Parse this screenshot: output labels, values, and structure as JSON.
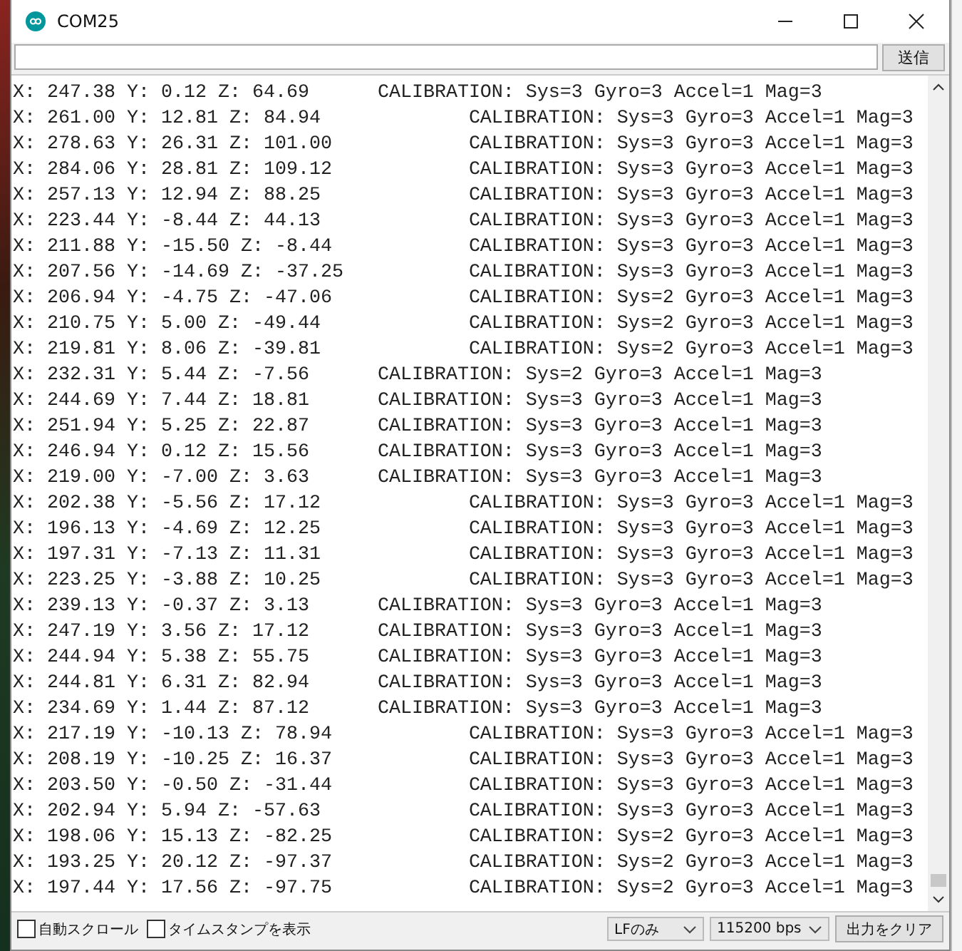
{
  "window": {
    "title": "COM25"
  },
  "input": {
    "button": "送信"
  },
  "output": {
    "lines": [
      "X: 247.38 Y: 0.12 Z: 64.69\tCALIBRATION: Sys=3 Gyro=3 Accel=1 Mag=3",
      "X: 261.00 Y: 12.81 Z: 84.94\t\tCALIBRATION: Sys=3 Gyro=3 Accel=1 Mag=3",
      "X: 278.63 Y: 26.31 Z: 101.00\t\tCALIBRATION: Sys=3 Gyro=3 Accel=1 Mag=3",
      "X: 284.06 Y: 28.81 Z: 109.12\t\tCALIBRATION: Sys=3 Gyro=3 Accel=1 Mag=3",
      "X: 257.13 Y: 12.94 Z: 88.25\t\tCALIBRATION: Sys=3 Gyro=3 Accel=1 Mag=3",
      "X: 223.44 Y: -8.44 Z: 44.13\t\tCALIBRATION: Sys=3 Gyro=3 Accel=1 Mag=3",
      "X: 211.88 Y: -15.50 Z: -8.44\t\tCALIBRATION: Sys=3 Gyro=3 Accel=1 Mag=3",
      "X: 207.56 Y: -14.69 Z: -37.25\t\tCALIBRATION: Sys=3 Gyro=3 Accel=1 Mag=3",
      "X: 206.94 Y: -4.75 Z: -47.06\t\tCALIBRATION: Sys=2 Gyro=3 Accel=1 Mag=3",
      "X: 210.75 Y: 5.00 Z: -49.44\t\tCALIBRATION: Sys=2 Gyro=3 Accel=1 Mag=3",
      "X: 219.81 Y: 8.06 Z: -39.81\t\tCALIBRATION: Sys=2 Gyro=3 Accel=1 Mag=3",
      "X: 232.31 Y: 5.44 Z: -7.56\tCALIBRATION: Sys=2 Gyro=3 Accel=1 Mag=3",
      "X: 244.69 Y: 7.44 Z: 18.81\tCALIBRATION: Sys=3 Gyro=3 Accel=1 Mag=3",
      "X: 251.94 Y: 5.25 Z: 22.87\tCALIBRATION: Sys=3 Gyro=3 Accel=1 Mag=3",
      "X: 246.94 Y: 0.12 Z: 15.56\tCALIBRATION: Sys=3 Gyro=3 Accel=1 Mag=3",
      "X: 219.00 Y: -7.00 Z: 3.63\tCALIBRATION: Sys=3 Gyro=3 Accel=1 Mag=3",
      "X: 202.38 Y: -5.56 Z: 17.12\t\tCALIBRATION: Sys=3 Gyro=3 Accel=1 Mag=3",
      "X: 196.13 Y: -4.69 Z: 12.25\t\tCALIBRATION: Sys=3 Gyro=3 Accel=1 Mag=3",
      "X: 197.31 Y: -7.13 Z: 11.31\t\tCALIBRATION: Sys=3 Gyro=3 Accel=1 Mag=3",
      "X: 223.25 Y: -3.88 Z: 10.25\t\tCALIBRATION: Sys=3 Gyro=3 Accel=1 Mag=3",
      "X: 239.13 Y: -0.37 Z: 3.13\tCALIBRATION: Sys=3 Gyro=3 Accel=1 Mag=3",
      "X: 247.19 Y: 3.56 Z: 17.12\tCALIBRATION: Sys=3 Gyro=3 Accel=1 Mag=3",
      "X: 244.94 Y: 5.38 Z: 55.75\tCALIBRATION: Sys=3 Gyro=3 Accel=1 Mag=3",
      "X: 244.81 Y: 6.31 Z: 82.94\tCALIBRATION: Sys=3 Gyro=3 Accel=1 Mag=3",
      "X: 234.69 Y: 1.44 Z: 87.12\tCALIBRATION: Sys=3 Gyro=3 Accel=1 Mag=3",
      "X: 217.19 Y: -10.13 Z: 78.94\t\tCALIBRATION: Sys=3 Gyro=3 Accel=1 Mag=3",
      "X: 208.19 Y: -10.25 Z: 16.37\t\tCALIBRATION: Sys=3 Gyro=3 Accel=1 Mag=3",
      "X: 203.50 Y: -0.50 Z: -31.44\t\tCALIBRATION: Sys=3 Gyro=3 Accel=1 Mag=3",
      "X: 202.94 Y: 5.94 Z: -57.63\t\tCALIBRATION: Sys=3 Gyro=3 Accel=1 Mag=3",
      "X: 198.06 Y: 15.13 Z: -82.25\t\tCALIBRATION: Sys=2 Gyro=3 Accel=1 Mag=3",
      "X: 193.25 Y: 20.12 Z: -97.37\t\tCALIBRATION: Sys=2 Gyro=3 Accel=1 Mag=3",
      "X: 197.44 Y: 17.56 Z: -97.75\t\tCALIBRATION: Sys=2 Gyro=3 Accel=1 Mag=3"
    ]
  },
  "options": [
    {
      "label": "自動スクロール",
      "checked": false
    },
    {
      "label": "タイムスタンプを表示",
      "checked": false
    }
  ],
  "line_ending": "LFのみ",
  "baud_rate": "115200 bps",
  "clear_button": "出力をクリア"
}
